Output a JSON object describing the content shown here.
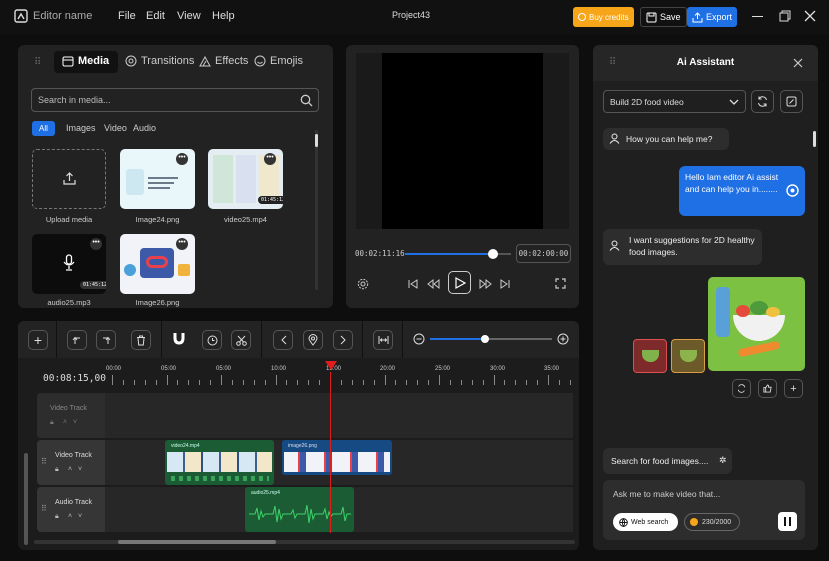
{
  "app": {
    "name": "Editor name",
    "project": "Project43"
  },
  "menu": [
    "File",
    "Edit",
    "View",
    "Help"
  ],
  "topbar": {
    "buy_credits": "Buy credits",
    "save": "Save",
    "export": "Export"
  },
  "media_panel": {
    "tabs": [
      "Media",
      "Transitions",
      "Effects",
      "Emojis"
    ],
    "search_placeholder": "Search in media...",
    "filters": [
      "All",
      "Images",
      "Video",
      "Audio"
    ],
    "items": [
      {
        "label": "Upload media"
      },
      {
        "label": "Image24.png"
      },
      {
        "label": "video25.mp4",
        "duration": "01:45:12"
      },
      {
        "label": "audio25.mp3",
        "duration": "01:45:12"
      },
      {
        "label": "Image26.png"
      }
    ]
  },
  "preview": {
    "current_time": "00:02:11:16",
    "total_time": "00:02:00:00",
    "progress": 0.83
  },
  "toolbar": {
    "zoom_level": 0.45
  },
  "timeline": {
    "timecode": "00:08:15,00",
    "ruler": [
      "00:00",
      "05:00",
      "05:00",
      "10:00",
      "15:00",
      "20:00",
      "25:00",
      "30:00",
      "35:00"
    ],
    "tracks": [
      {
        "name": "Video Track"
      },
      {
        "name": "Video Track",
        "clips": [
          "video24.mp4",
          "image26.png"
        ]
      },
      {
        "name": "Audio Track",
        "clips": [
          "audio25.mp4"
        ]
      }
    ]
  },
  "assistant": {
    "title": "Ai Assistant",
    "preset": "Build 2D food video",
    "messages": [
      {
        "from": "user",
        "text": "How you can help me?"
      },
      {
        "from": "ai",
        "text": "Hello Iam editor Ai assist and can help you in........"
      },
      {
        "from": "user",
        "text": "I want suggestions for 2D healthy food images."
      }
    ],
    "search_status": "Search for food images....",
    "input_placeholder": "Ask me to make video that...",
    "web_search": "Web search",
    "credits": "230/2000"
  },
  "colors": {
    "accent": "#1f6fe5",
    "orange": "#f7a61a",
    "clip_green": "#1c5c34",
    "playhead": "#e01c1c"
  }
}
